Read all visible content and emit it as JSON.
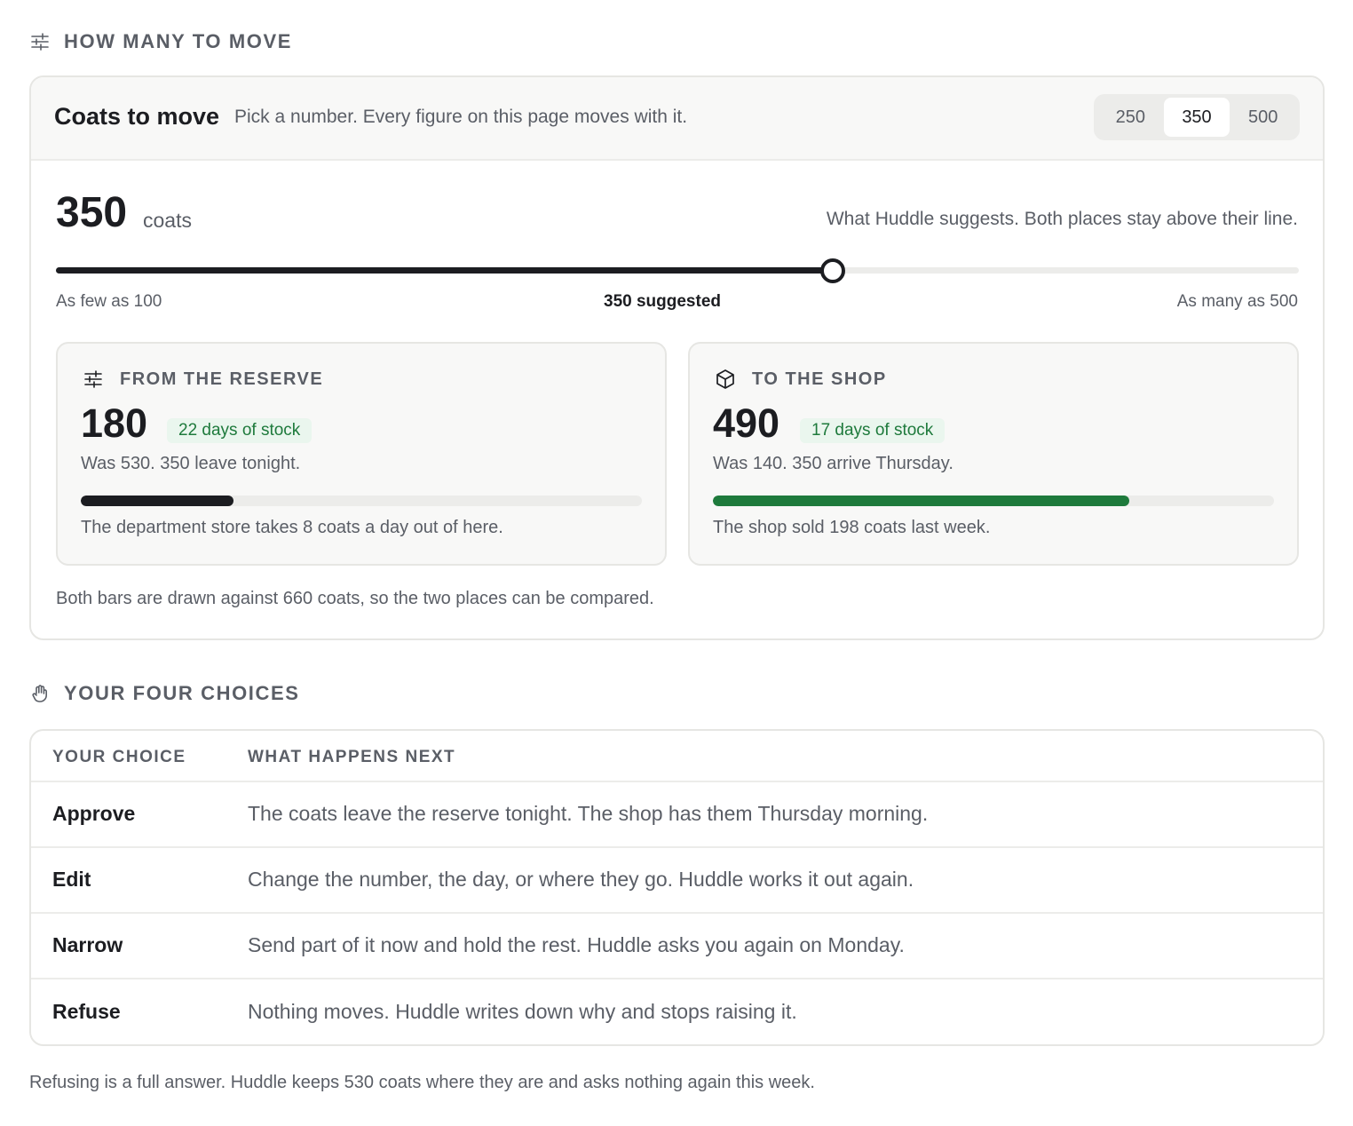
{
  "move_section": {
    "heading": "HOW MANY TO MOVE",
    "icon": "sliders-icon"
  },
  "coats_card": {
    "title": "Coats to move",
    "subtitle": "Pick a number. Every figure on this page moves with it.",
    "options": [
      "250",
      "350",
      "500"
    ],
    "selected_option": "350",
    "amount": "350",
    "unit": "coats",
    "suggestion_note": "What Huddle suggests. Both places stay above their line.",
    "slider": {
      "min": 100,
      "max": 500,
      "value": 350,
      "min_label": "As few as 100",
      "mid_label": "350 suggested",
      "max_label": "As many as 500"
    },
    "reserve": {
      "icon": "sliders-icon",
      "label": "FROM THE RESERVE",
      "count": "180",
      "badge": "22 days of stock",
      "was": "Was 530. 350 leave tonight.",
      "bar_value": 180,
      "bar_color": "#1c1d21",
      "note": "The department store takes 8 coats a day out of here."
    },
    "shop": {
      "icon": "box-icon",
      "label": "TO THE SHOP",
      "count": "490",
      "badge": "17 days of stock",
      "was": "Was 140. 350 arrive Thursday.",
      "bar_value": 490,
      "bar_color": "#1e7a3c",
      "note": "The shop sold 198 coats last week."
    },
    "bar_scale_max": 660,
    "footer": "Both bars are drawn against 660 coats, so the two places can be compared."
  },
  "choices_section": {
    "heading": "YOUR FOUR CHOICES",
    "icon": "hand-icon"
  },
  "choices_table": {
    "headers": [
      "YOUR CHOICE",
      "WHAT HAPPENS NEXT"
    ],
    "rows": [
      {
        "choice": "Approve",
        "next": "The coats leave the reserve tonight. The shop has them Thursday morning."
      },
      {
        "choice": "Edit",
        "next": "Change the number, the day, or where they go. Huddle works it out again."
      },
      {
        "choice": "Narrow",
        "next": "Send part of it now and hold the rest. Huddle asks you again on Monday."
      },
      {
        "choice": "Refuse",
        "next": "Nothing moves. Huddle writes down why and stops raising it."
      }
    ]
  },
  "footnote": "Refusing is a full answer. Huddle keeps 530 coats where they are and asks nothing again this week."
}
